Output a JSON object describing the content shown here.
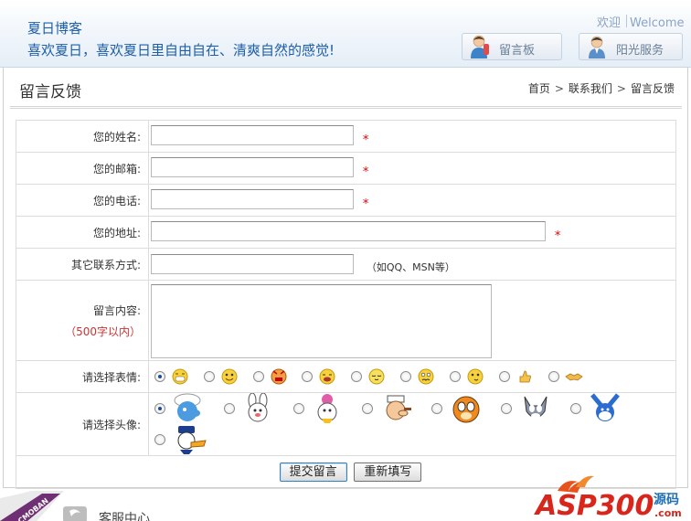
{
  "header": {
    "site_title": "夏日博客",
    "slogan": "喜欢夏日，喜欢夏日里自由自在、清爽自然的感觉!",
    "welcome_cn": "欢迎",
    "welcome_en": "Welcome",
    "guestbook_btn": "留言板",
    "service_btn": "阳光服务"
  },
  "page": {
    "title": "留言反馈",
    "breadcrumb": [
      "首页",
      "联系我们",
      "留言反馈"
    ],
    "breadcrumb_sep": ">"
  },
  "form": {
    "name_label": "您的姓名:",
    "email_label": "您的邮箱:",
    "phone_label": "您的电话:",
    "address_label": "您的地址:",
    "other_label": "其它联系方式:",
    "other_hint": "（如QQ、MSN等）",
    "message_label": "留言内容:",
    "message_sub": "（500字以内）",
    "emotion_label": "请选择表情:",
    "avatar_label": "请选择头像:",
    "required_mark": "*",
    "values": {
      "name": "",
      "email": "",
      "phone": "",
      "address": "",
      "other": "",
      "message": ""
    },
    "emotions": [
      "grin",
      "smile",
      "angry",
      "cry",
      "sleepy",
      "worried",
      "laugh",
      "thumbs-up",
      "handshake"
    ],
    "emotion_selected": 0,
    "avatars": [
      "smurf",
      "rabbit",
      "girl-mouse",
      "popeye",
      "garfield",
      "tom-cat",
      "buster-bunny",
      "donald-duck"
    ],
    "avatar_selected": 0,
    "submit_label": "提交留言",
    "reset_label": "重新填写"
  },
  "footer": {
    "corner_text": "CMOBAN",
    "service_label": "客服中心",
    "logo_text": "ASP300",
    "logo_suffix": "源码",
    "logo_domain": ".com"
  },
  "colors": {
    "title_blue": "#1d5fa8",
    "required_red": "#dd0000",
    "logo_red": "#d9261c",
    "logo_blue": "#1f6fb8"
  }
}
